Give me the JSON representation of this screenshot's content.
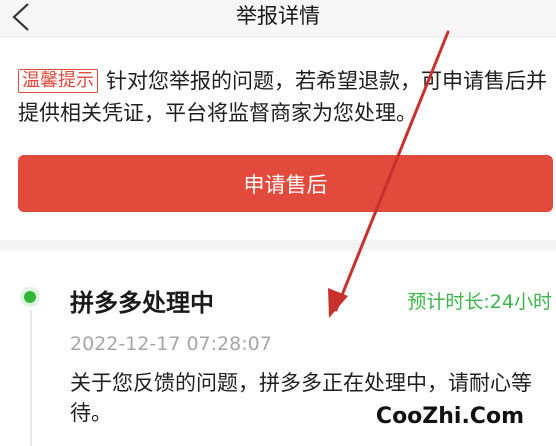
{
  "header": {
    "title": "举报详情",
    "back_icon": "chevron-left-icon"
  },
  "notice": {
    "tag": "温馨提示",
    "text": "针对您举报的问题，若希望退款，可申请售后并提供相关凭证，平台将监督商家为您处理。"
  },
  "actions": {
    "after_sale_label": "申请售后",
    "button_color": "#e24a3b"
  },
  "status": {
    "title": "拼多多处理中",
    "eta": "预计时长:24小时",
    "timestamp": "2022-12-17 07:28:07",
    "description": "关于您反馈的问题，拼多多正在处理中，请耐心等待。",
    "dot_color": "#33b53a"
  },
  "annotation": {
    "arrow_color": "#c8302c"
  },
  "watermark": {
    "text": "CooZhi.Com"
  }
}
